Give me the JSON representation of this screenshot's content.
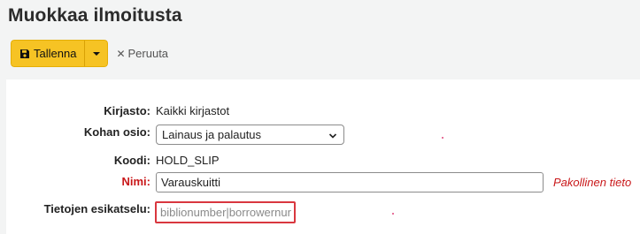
{
  "page": {
    "title": "Muokkaa ilmoitusta"
  },
  "toolbar": {
    "save_label": "Tallenna",
    "save_icon": "floppy-disk-icon",
    "cancel_label": "Peruuta",
    "cancel_icon": "close-icon",
    "accent_color": "#f6c324"
  },
  "form": {
    "library": {
      "label": "Kirjasto:",
      "value": "Kaikki kirjastot"
    },
    "module": {
      "label": "Kohan osio:",
      "selected": "Lainaus ja palautus"
    },
    "code": {
      "label": "Koodi:",
      "value": "HOLD_SLIP"
    },
    "name": {
      "label": "Nimi:",
      "value": "Varauskuitti",
      "required_hint": "Pakollinen tieto",
      "required_color": "#c9181a"
    },
    "preview": {
      "label": "Tietojen esikatselu:",
      "value": "biblionumber|borrowernur"
    }
  }
}
